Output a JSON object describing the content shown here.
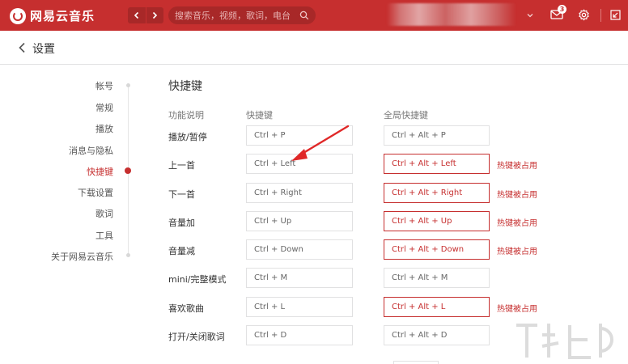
{
  "app": {
    "name": "网易云音乐",
    "search_placeholder": "搜索音乐，视频，歌词，电台",
    "mail_count": "3"
  },
  "page": {
    "title": "设置"
  },
  "sidebar": {
    "items": [
      {
        "label": "帐号",
        "active": false
      },
      {
        "label": "常规",
        "active": false
      },
      {
        "label": "播放",
        "active": false
      },
      {
        "label": "消息与隐私",
        "active": false
      },
      {
        "label": "快捷键",
        "active": true
      },
      {
        "label": "下载设置",
        "active": false
      },
      {
        "label": "歌词",
        "active": false
      },
      {
        "label": "工具",
        "active": false
      },
      {
        "label": "关于网易云音乐",
        "active": false
      }
    ]
  },
  "shortcuts": {
    "section_title": "快捷键",
    "columns": {
      "function": "功能说明",
      "local": "快捷键",
      "global": "全局快捷键"
    },
    "conflict_text": "热键被占用",
    "rows": [
      {
        "label": "播放/暂停",
        "local": "Ctrl + P",
        "global": "Ctrl + Alt + P",
        "conflict": false
      },
      {
        "label": "上一首",
        "local": "Ctrl + Left",
        "global": "Ctrl + Alt + Left",
        "conflict": true
      },
      {
        "label": "下一首",
        "local": "Ctrl + Right",
        "global": "Ctrl + Alt + Right",
        "conflict": true
      },
      {
        "label": "音量加",
        "local": "Ctrl + Up",
        "global": "Ctrl + Alt + Up",
        "conflict": true
      },
      {
        "label": "音量减",
        "local": "Ctrl + Down",
        "global": "Ctrl + Alt + Down",
        "conflict": true
      },
      {
        "label": "mini/完整模式",
        "local": "Ctrl + M",
        "global": "Ctrl + Alt + M",
        "conflict": false
      },
      {
        "label": "喜欢歌曲",
        "local": "Ctrl + L",
        "global": "Ctrl + Alt + L",
        "conflict": true
      },
      {
        "label": "打开/关闭歌词",
        "local": "Ctrl + D",
        "global": "Ctrl + Alt + D",
        "conflict": false
      }
    ]
  },
  "colors": {
    "brand": "#c62f2f",
    "border": "#e1e1e2"
  },
  "icons": [
    "netease-logo-icon",
    "chevron-left-icon",
    "chevron-right-icon",
    "search-icon",
    "chevron-down-icon",
    "mail-icon",
    "gear-icon",
    "mini-mode-icon",
    "back-icon"
  ]
}
